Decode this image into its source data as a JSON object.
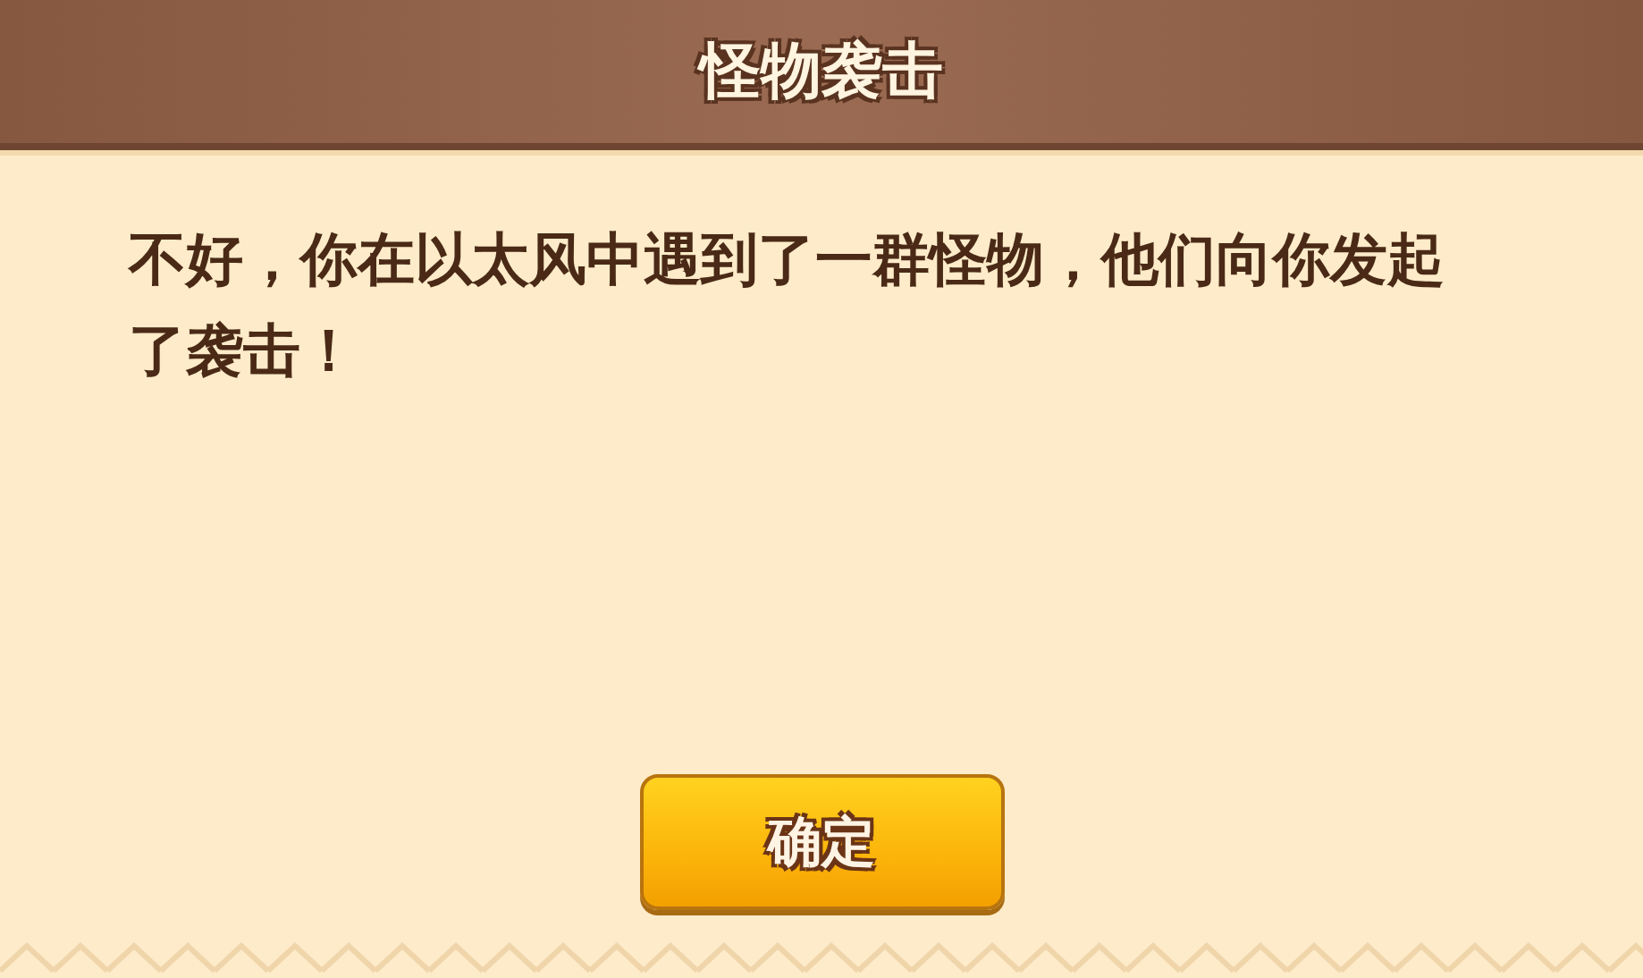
{
  "dialog": {
    "title": "怪物袭击",
    "message": "不好，你在以太风中遇到了一群怪物，他们向你发起了袭击！",
    "buttons": [
      "确定"
    ]
  }
}
